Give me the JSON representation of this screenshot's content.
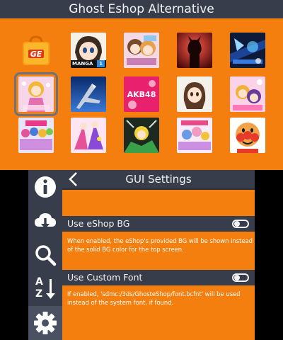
{
  "app": {
    "title": "Ghost Eshop Alternative"
  },
  "grid": {
    "tiles": [
      {
        "name": "ghost-eshop-app-icon",
        "label": "GE"
      },
      {
        "name": "manga-app-icon",
        "label": "MANGA",
        "badge": "1"
      },
      {
        "name": "anime-couple-game-icon"
      },
      {
        "name": "silhouette-hero-game-icon"
      },
      {
        "name": "blue-cyber-game-icon"
      },
      {
        "name": "pink-idol-game-icon",
        "selected": true
      },
      {
        "name": "jet-fighter-game-icon"
      },
      {
        "name": "akb48-game-icon",
        "label": "AKB48"
      },
      {
        "name": "brown-hair-girl-game-icon"
      },
      {
        "name": "pretty-rhythm-game-icon"
      },
      {
        "name": "idol-group-game-icon"
      },
      {
        "name": "magical-girls-game-icon"
      },
      {
        "name": "green-adventure-game-icon"
      },
      {
        "name": "festival-idols-game-icon"
      },
      {
        "name": "anpanman-game-icon"
      }
    ]
  },
  "sidebar": {
    "items": [
      {
        "icon": "info-icon"
      },
      {
        "icon": "cloud-download-icon"
      },
      {
        "icon": "search-icon"
      },
      {
        "icon": "sort-az-icon",
        "letter_top": "A",
        "letter_bottom": "Z"
      },
      {
        "icon": "gear-icon",
        "active": true
      }
    ]
  },
  "settings": {
    "title": "GUI Settings",
    "options": [
      {
        "label": "Use eShop BG",
        "enabled": false,
        "description": "When enabled, the eShop's provided BG will be shown instead of the solid BG color for the top screen."
      },
      {
        "label": "Use Custom Font",
        "enabled": false,
        "description": "If enabled, 'sdmc:/3ds/GhosteShop/font.bcfnt' will be used instead of the system font, if found."
      }
    ]
  },
  "colors": {
    "accent": "#f47f0e",
    "bar": "#373d4b",
    "text": "#f2f2f2"
  }
}
